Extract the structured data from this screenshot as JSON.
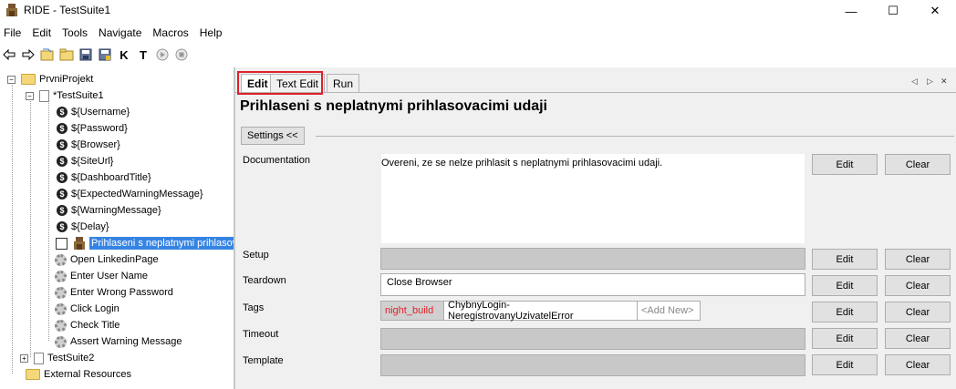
{
  "window": {
    "title": "RIDE - TestSuite1",
    "controls": {
      "minimize": "—",
      "maximize": "☐",
      "close": "✕"
    }
  },
  "menu": [
    "File",
    "Edit",
    "Tools",
    "Navigate",
    "Macros",
    "Help"
  ],
  "toolbar": {
    "icons": [
      "back-arrow-icon",
      "forward-arrow-icon",
      "open-folder-icon",
      "open-directory-icon",
      "save-icon",
      "save-all-icon",
      "search-keywords-icon",
      "search-tests-icon",
      "run-icon",
      "stop-icon"
    ],
    "keyword_search_glyph": "K",
    "test_search_glyph": "T"
  },
  "tree": {
    "project": "PrvniProjekt",
    "suite1": "*TestSuite1",
    "variables": [
      "${Username}",
      "${Password}",
      "${Browser}",
      "${SiteUrl}",
      "${DashboardTitle}",
      "${ExpectedWarningMessage}",
      "${WarningMessage}",
      "${Delay}"
    ],
    "variable_glyph": "$",
    "selected_test": "Prihlaseni s neplatnymi prihlasov",
    "keywords": [
      "Open LinkedinPage",
      "Enter User Name",
      "Enter Wrong Password",
      "Click Login",
      "Check Title",
      "Assert Warning Message"
    ],
    "suite2": "TestSuite2",
    "external": "External Resources"
  },
  "tabs": {
    "edit": "Edit",
    "text_edit": "Text Edit",
    "run": "Run"
  },
  "tab_arrows": {
    "left": "◁",
    "right": "▷",
    "close": "✕"
  },
  "editor": {
    "heading": "Prihlaseni s neplatnymi prihlasovacimi udaji",
    "settings_toggle": "Settings <<",
    "edit_label": "Edit",
    "clear_label": "Clear",
    "documentation": {
      "label": "Documentation",
      "value": "Overeni, ze se nelze prihlasit s neplatnymi prihlasovacimi udaji."
    },
    "setup": {
      "label": "Setup",
      "value": ""
    },
    "teardown": {
      "label": "Teardown",
      "value": "Close Browser"
    },
    "tags": {
      "label": "Tags",
      "items": [
        {
          "text": "night_build",
          "color": "#e0202a",
          "bg": "#d0d0d0"
        },
        {
          "text": "ChybnyLogin-NeregistrovanyUzivatelError",
          "color": "#000000",
          "bg": "#ffffff"
        }
      ],
      "add_new": "<Add New>"
    },
    "timeout": {
      "label": "Timeout",
      "value": ""
    },
    "template": {
      "label": "Template",
      "value": ""
    }
  }
}
